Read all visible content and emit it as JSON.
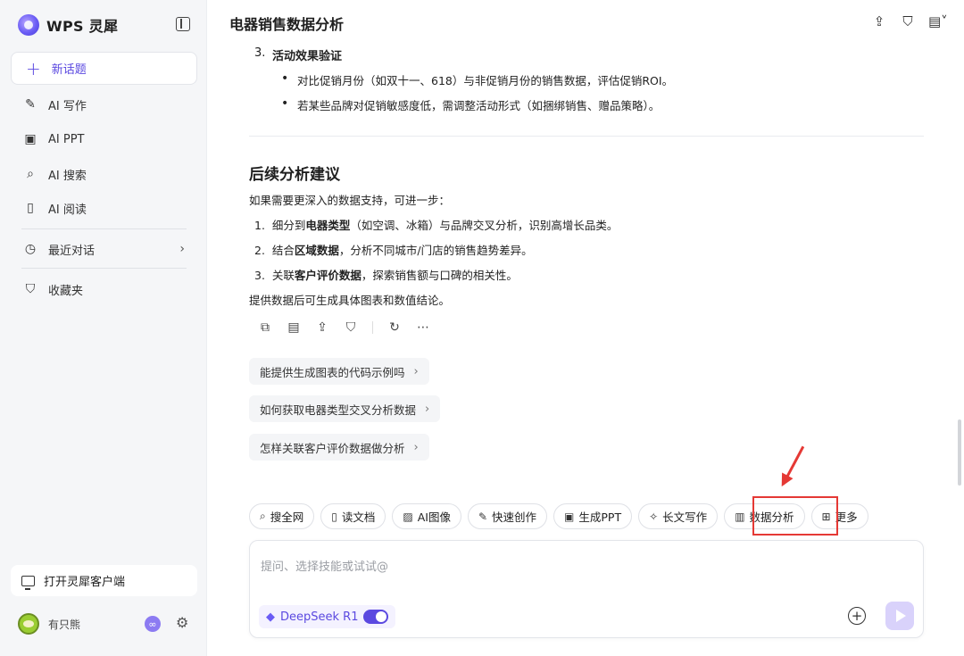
{
  "sidebar": {
    "brand": "WPS 灵犀",
    "new_topic": "新话题",
    "items": [
      {
        "label": "AI 写作",
        "icon": "pen-icon"
      },
      {
        "label": "AI PPT",
        "icon": "ppt-icon"
      },
      {
        "label": "AI 搜索",
        "icon": "search-icon"
      },
      {
        "label": "AI 阅读",
        "icon": "book-icon"
      }
    ],
    "recent": "最近对话",
    "favorites": "收藏夹",
    "client_button": "打开灵犀客户端",
    "user_name": "有只熊"
  },
  "header": {
    "title": "电器销售数据分析"
  },
  "content": {
    "item3_num": "3.",
    "item3_title": "活动效果验证",
    "bullet1": "对比促销月份（如双十一、618）与非促销月份的销售数据，评估促销ROI。",
    "bullet2": "若某些品牌对促销敏感度低，需调整活动形式（如捆绑销售、赠品策略）。",
    "section_title": "后续分析建议",
    "intro": "如果需要更深入的数据支持，可进一步：",
    "steps": [
      {
        "num": "1.",
        "pre": "细分到",
        "bold": "电器类型",
        "post": "（如空调、冰箱）与品牌交叉分析，识别高增长品类。"
      },
      {
        "num": "2.",
        "pre": "结合",
        "bold": "区域数据",
        "post": "，分析不同城市/门店的销售趋势差异。"
      },
      {
        "num": "3.",
        "pre": "关联",
        "bold": "客户评价数据",
        "post": "，探索销售额与口碑的相关性。"
      }
    ],
    "closing": "提供数据后可生成具体图表和数值结论。"
  },
  "suggestions": [
    "能提供生成图表的代码示例吗",
    "如何获取电器类型交叉分析数据",
    "怎样关联客户评价数据做分析"
  ],
  "tools": [
    {
      "label": "搜全网",
      "icon": "search-icon"
    },
    {
      "label": "读文档",
      "icon": "book-icon"
    },
    {
      "label": "AI图像",
      "icon": "image-icon"
    },
    {
      "label": "快速创作",
      "icon": "pen-icon"
    },
    {
      "label": "生成PPT",
      "icon": "ppt-icon"
    },
    {
      "label": "长文写作",
      "icon": "sparkle-icon"
    },
    {
      "label": "数据分析",
      "icon": "chart-icon"
    },
    {
      "label": "更多",
      "icon": "grid-icon"
    }
  ],
  "input": {
    "placeholder": "提问、选择技能或试试@",
    "model": "DeepSeek R1",
    "model_enabled": true
  },
  "colors": {
    "accent": "#5b49e0",
    "highlight": "#e53935"
  }
}
